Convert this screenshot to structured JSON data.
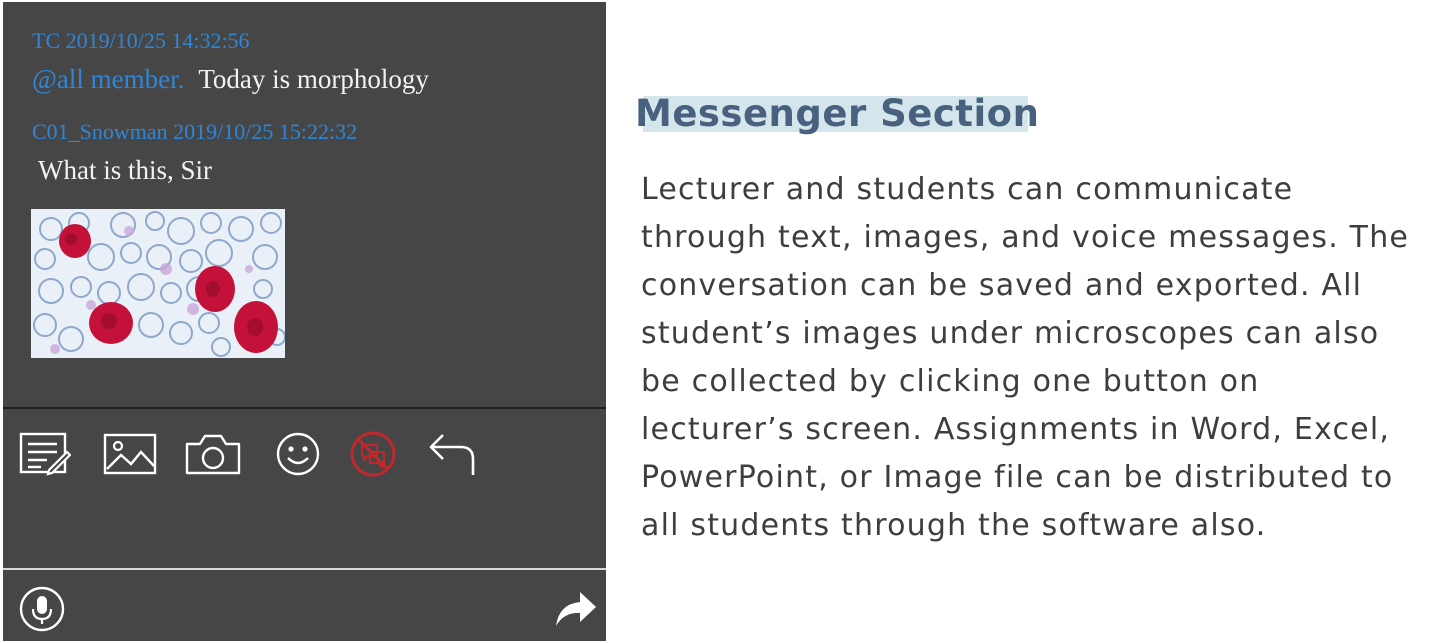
{
  "chat": {
    "messages": [
      {
        "meta": "TC 2019/10/25 14:32:56",
        "mention": "@all member.",
        "text": "Today is morphology"
      },
      {
        "meta": "C01_Snowman 2019/10/25 15:22:32",
        "text": "What is this, Sir"
      }
    ],
    "image_subject": "microscope-slide-plant-tissue"
  },
  "toolbar": {
    "icons": [
      "edit-text-icon",
      "image-icon",
      "camera-icon",
      "emoji-icon",
      "chat-disabled-icon",
      "undo-icon"
    ]
  },
  "bottom_bar": {
    "icons": [
      "microphone-icon",
      "send-forward-icon"
    ]
  },
  "info": {
    "title": "Messenger Section",
    "lines": [
      "Lecturer and students can communicate",
      "through text, images, and voice messages. The",
      "conversation can be saved and exported. All",
      "student’s images under microscopes can also",
      "be collected by clicking one button on",
      "lecturer’s screen. Assignments in Word, Excel,",
      "PowerPoint, or Image file can be distributed to",
      "all students through the software also."
    ]
  },
  "colors": {
    "panel_bg": "#464646",
    "meta_blue": "#2f86d6",
    "title_color": "#48617f",
    "title_highlight": "#d4e6ec",
    "body_text": "#3e3e3e",
    "disabled_red": "#c0282d"
  }
}
